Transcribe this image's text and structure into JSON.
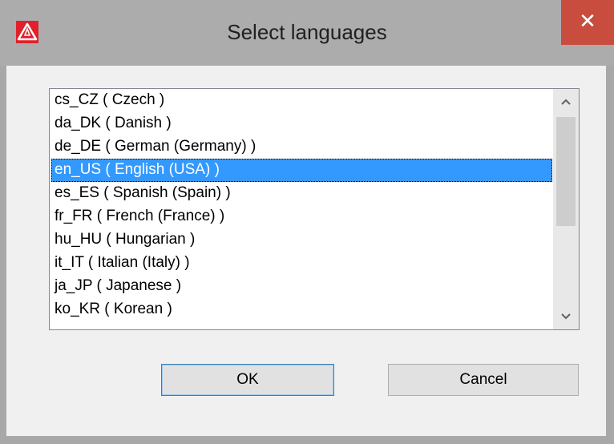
{
  "window": {
    "title": "Select languages",
    "close_label": "✕"
  },
  "languages": {
    "items": [
      "cs_CZ ( Czech )",
      "da_DK ( Danish )",
      "de_DE ( German (Germany) )",
      "en_US ( English (USA) )",
      "es_ES ( Spanish (Spain) )",
      "fr_FR ( French (France) )",
      "hu_HU ( Hungarian )",
      "it_IT ( Italian (Italy) )",
      "ja_JP ( Japanese )",
      "ko_KR ( Korean )"
    ],
    "selected_index": 3
  },
  "buttons": {
    "ok_label": "OK",
    "cancel_label": "Cancel"
  },
  "colors": {
    "accent": "#3399ff",
    "close": "#c94d3f",
    "app_icon": "#e0202a"
  },
  "icons": {
    "app": "warning-triangle-icon",
    "close": "close-icon",
    "scroll_up": "chevron-up-icon",
    "scroll_down": "chevron-down-icon"
  }
}
